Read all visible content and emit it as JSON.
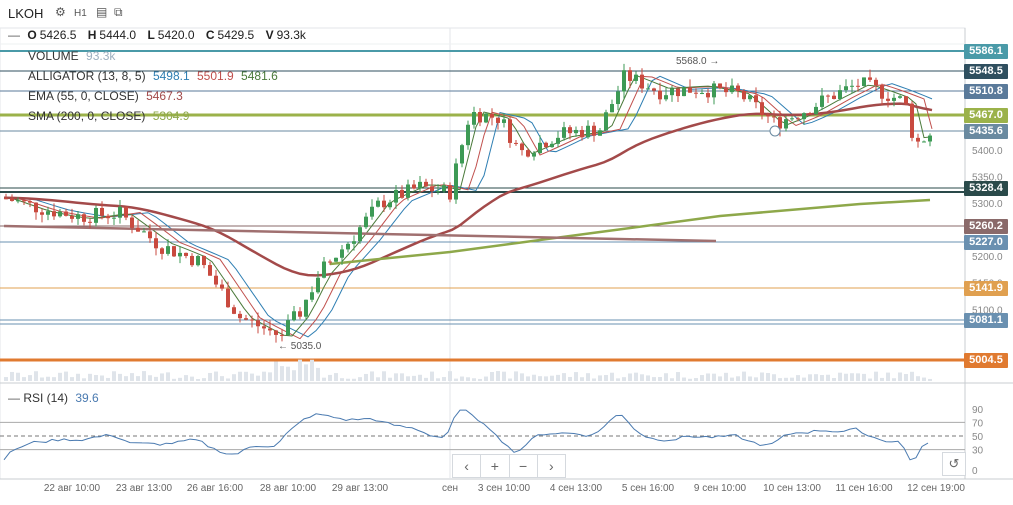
{
  "ticker": "LKOH",
  "interval": "H1",
  "ohlc": {
    "o_label": "O",
    "o": "5426.5",
    "h_label": "H",
    "h": "5444.0",
    "l_label": "L",
    "l": "5420.0",
    "c_label": "C",
    "c": "5429.5",
    "v_label": "V",
    "v": "93.3k"
  },
  "indicators": [
    {
      "name": "VOLUME",
      "values": [
        "93.3k"
      ],
      "colors": [
        "#9eb0c0"
      ]
    },
    {
      "name": "ALLIGATOR (13, 8, 5)",
      "values": [
        "5498.1",
        "5501.9",
        "5481.6"
      ],
      "colors": [
        "#2f7fb3",
        "#c0504d",
        "#4a7a3a"
      ]
    },
    {
      "name": "EMA (55, 0, CLOSE)",
      "values": [
        "5467.3"
      ],
      "colors": [
        "#a34a4a"
      ]
    },
    {
      "name": "SMA (200, 0, CLOSE)",
      "values": [
        "5304.9"
      ],
      "colors": [
        "#8ea84a"
      ]
    }
  ],
  "rsi": {
    "label": "RSI (14)",
    "value": "39.6",
    "levels": [
      "90",
      "70",
      "50",
      "30",
      "0"
    ]
  },
  "price_labels": [
    {
      "text": "5586.1",
      "bg": "#4a9aa8",
      "fg": "#ffffff"
    },
    {
      "text": "5548.5",
      "bg": "#2f4f5f",
      "fg": "#ffffff"
    },
    {
      "text": "5510.8",
      "bg": "#5a7a9a",
      "fg": "#ffffff"
    },
    {
      "text": "5467.0",
      "bg": "#9bb24a",
      "fg": "#ffffff"
    },
    {
      "text": "5435.6",
      "bg": "#6a8aa0",
      "fg": "#ffffff"
    },
    {
      "text": "5328.4",
      "bg": "#2a4a4a",
      "fg": "#ffffff"
    },
    {
      "text": "5260.2",
      "bg": "#8a6a6a",
      "fg": "#ffffff"
    },
    {
      "text": "5227.0",
      "bg": "#6a90b0",
      "fg": "#ffffff"
    },
    {
      "text": "5141.9",
      "bg": "#e0a050",
      "fg": "#ffffff"
    },
    {
      "text": "5081.1",
      "bg": "#6a90b0",
      "fg": "#ffffff"
    },
    {
      "text": "5004.5",
      "bg": "#e07a30",
      "fg": "#ffffff"
    }
  ],
  "price_axis": [
    "5400.0",
    "5350.0",
    "5300.0",
    "5200.0",
    "5150.0",
    "5100.0"
  ],
  "annotations": {
    "high": "5568.0",
    "low": "5035.0"
  },
  "time_axis": [
    "22 авг 10:00",
    "23 авг 13:00",
    "26 авг 16:00",
    "28 авг 10:00",
    "29 авг 13:00",
    "сен",
    "3 сен 10:00",
    "4 сен 13:00",
    "5 сен 16:00",
    "9 сен 10:00",
    "10 сен 13:00",
    "11 сен 16:00",
    "12 сен 19:00"
  ],
  "zoom_controls": [
    "‹",
    "+",
    "−",
    "›"
  ],
  "reset_icon": "↺"
}
